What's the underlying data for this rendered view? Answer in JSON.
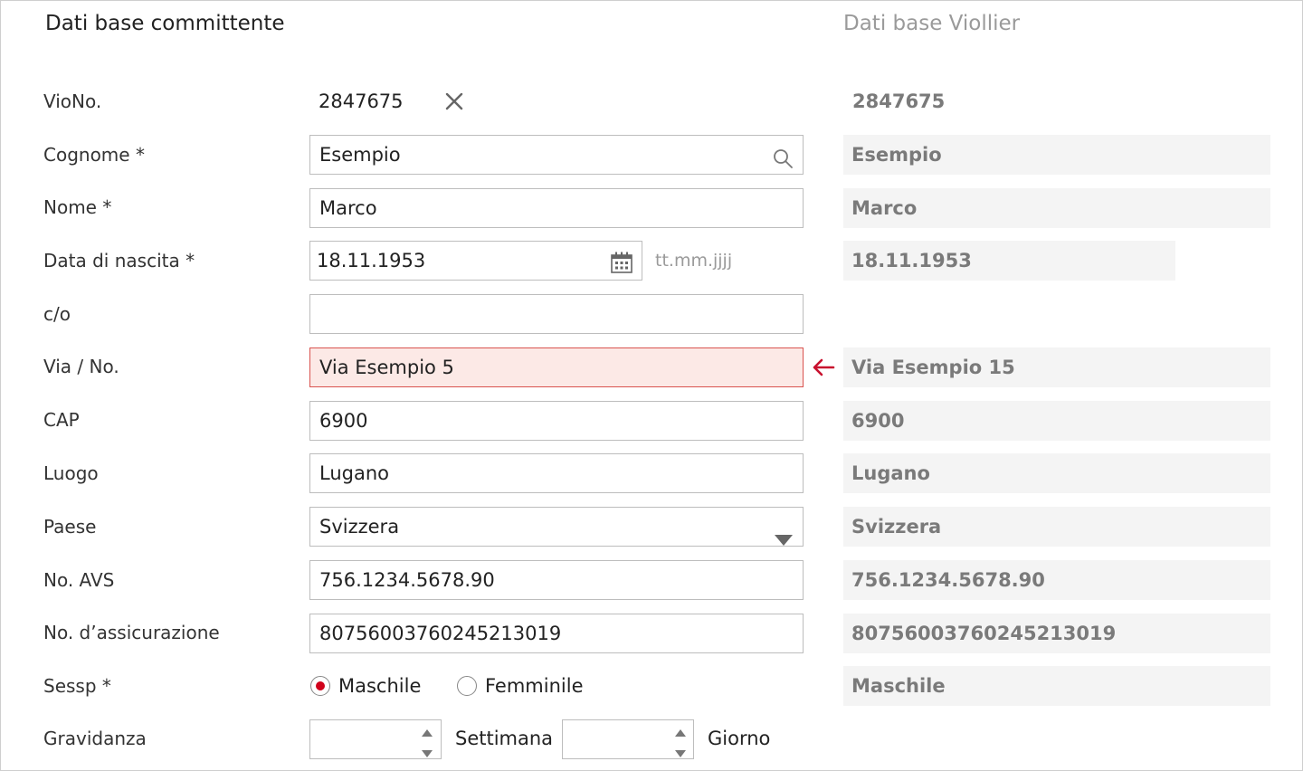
{
  "headers": {
    "left": "Dati base committente",
    "right": "Dati base Viollier"
  },
  "fields": {
    "vio_no": {
      "label": "VioNo.",
      "value": "2847675",
      "viollier": "2847675"
    },
    "cognome": {
      "label": "Cognome *",
      "value": "Esempio",
      "viollier": "Esempio"
    },
    "nome": {
      "label": "Nome *",
      "value": "Marco",
      "viollier": "Marco"
    },
    "data_nascita": {
      "label": "Data di nascita *",
      "value": "18.11.1953",
      "placeholder_hint": "tt.mm.jjjj",
      "viollier": "18.11.1953"
    },
    "co": {
      "label": "c/o",
      "value": ""
    },
    "via": {
      "label": "Via / No.",
      "value": "Via Esempio 5",
      "viollier": "Via Esempio 15"
    },
    "cap": {
      "label": "CAP",
      "value": "6900",
      "viollier": "6900"
    },
    "luogo": {
      "label": "Luogo",
      "value": "Lugano",
      "viollier": "Lugano"
    },
    "paese": {
      "label": "Paese",
      "value": "Svizzera",
      "viollier": "Svizzera"
    },
    "avs": {
      "label": "No. AVS",
      "value": "756.1234.5678.90",
      "viollier": "756.1234.5678.90"
    },
    "assicurazione": {
      "label": "No. d’assicurazione",
      "value": "80756003760245213019",
      "viollier": "80756003760245213019"
    },
    "sesso": {
      "label": "Sessp *",
      "options": [
        "Maschile",
        "Femminile"
      ],
      "selected": "Maschile",
      "viollier": "Maschile"
    },
    "gravidanza": {
      "label": "Gravidanza",
      "unit_week": "Settimana",
      "unit_day": "Giorno"
    }
  },
  "colors": {
    "error_bg": "#fce9e6",
    "error_border": "#d9534f",
    "accent_red": "#c8102e",
    "readonly_bg": "#f4f4f4"
  },
  "icons": {
    "clear": "close-icon",
    "search": "search-icon",
    "calendar": "calendar-icon",
    "dropdown": "caret-down-icon",
    "copy_from_viollier": "arrow-left-icon",
    "spinner": "spinner-arrows-icon"
  }
}
